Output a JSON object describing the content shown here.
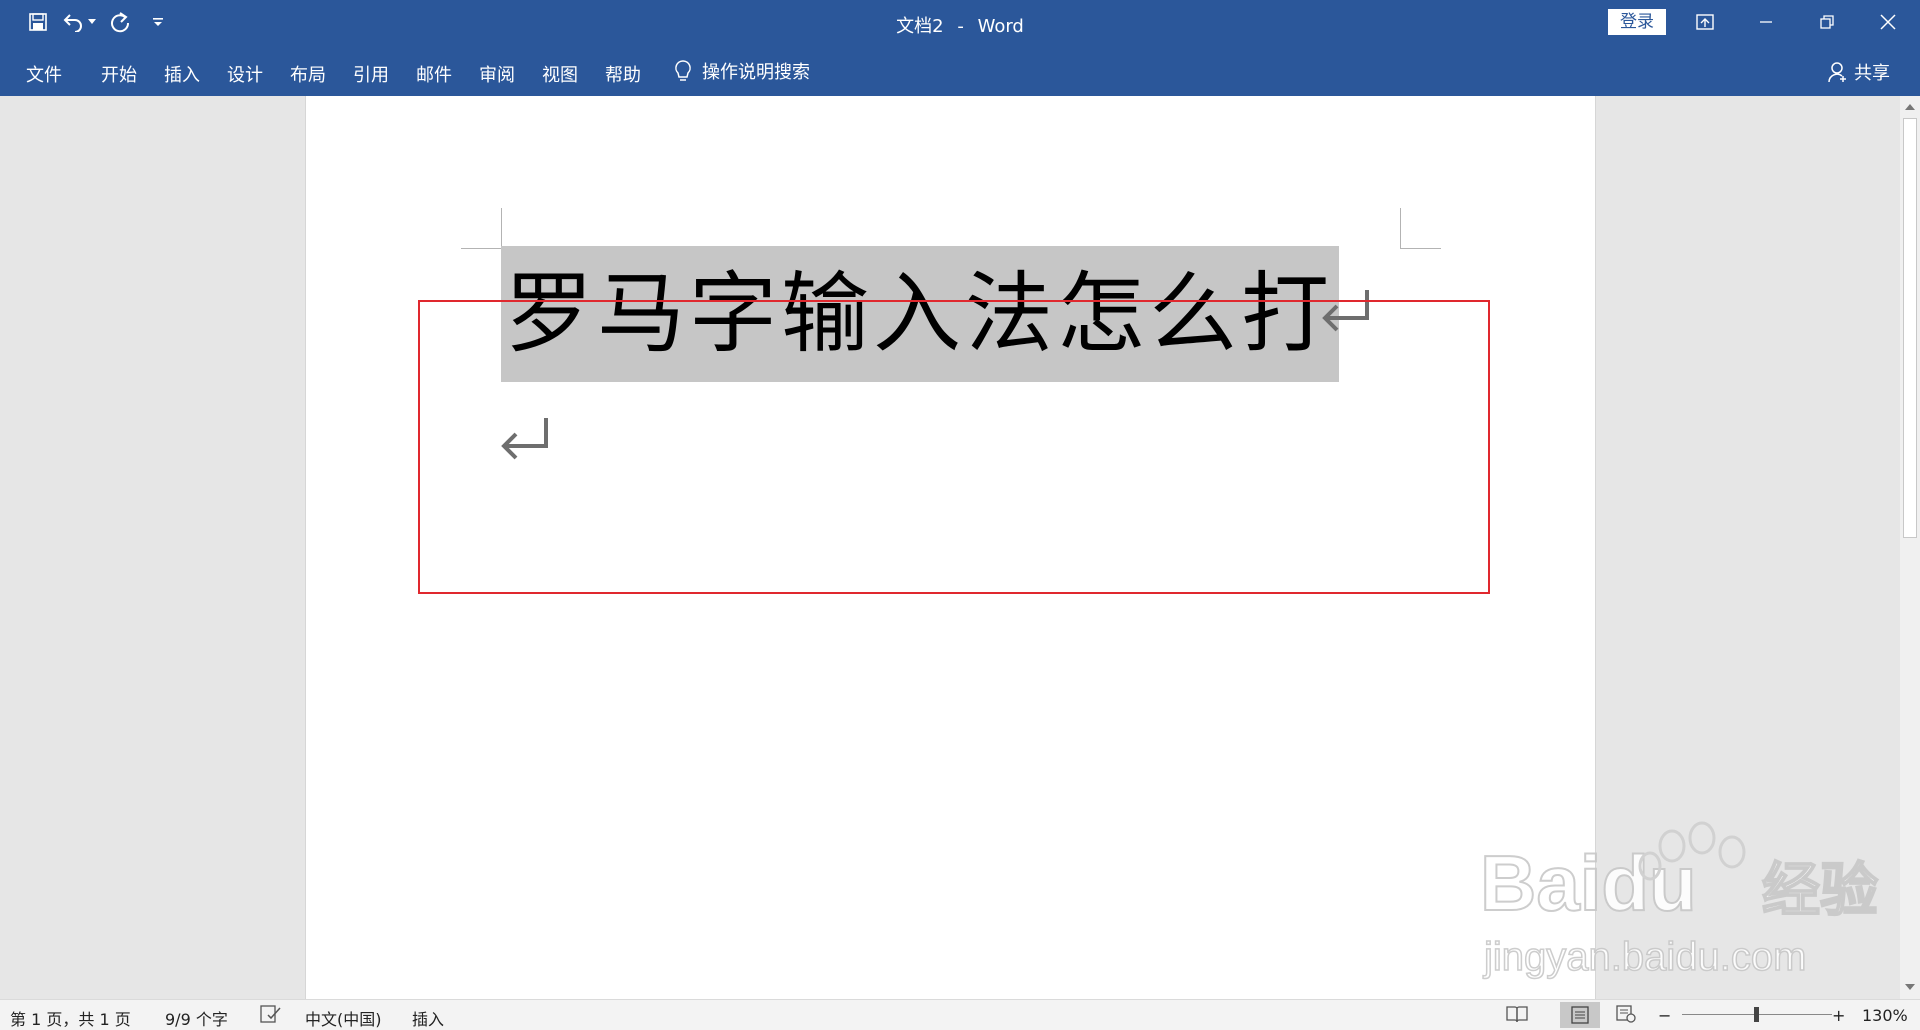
{
  "app": {
    "doc_title": "文档2",
    "separator": "-",
    "app_name": "Word",
    "login_label": "登录"
  },
  "quick_access": {
    "icons": [
      "save-icon",
      "undo-icon",
      "undo-dropdown-icon",
      "redo-icon",
      "customize-qat-icon"
    ]
  },
  "window_controls": [
    "ribbon-display-options-icon",
    "minimize-icon",
    "restore-icon",
    "close-icon"
  ],
  "ribbon": {
    "tabs": [
      "文件",
      "开始",
      "插入",
      "设计",
      "布局",
      "引用",
      "邮件",
      "审阅",
      "视图",
      "帮助"
    ],
    "tell_me": "操作说明搜索",
    "share": "共享"
  },
  "document": {
    "line1_text": "罗马字输入法怎么打",
    "paragraph_mark": "↵",
    "line1_selected": true,
    "highlight_box_color": "#e0282e"
  },
  "statusbar": {
    "page_info": "第 1 页，共 1 页",
    "word_count": "9/9 个字",
    "language": "中文(中国)",
    "mode": "插入",
    "zoom_minus": "−",
    "zoom_plus": "+",
    "zoom_level": "130%"
  },
  "watermark": {
    "brand": "Baidu",
    "brand_cn": "经验",
    "url": "jingyan.baidu.com"
  },
  "colors": {
    "accent": "#2b579a",
    "selection": "#c6c6c6"
  }
}
